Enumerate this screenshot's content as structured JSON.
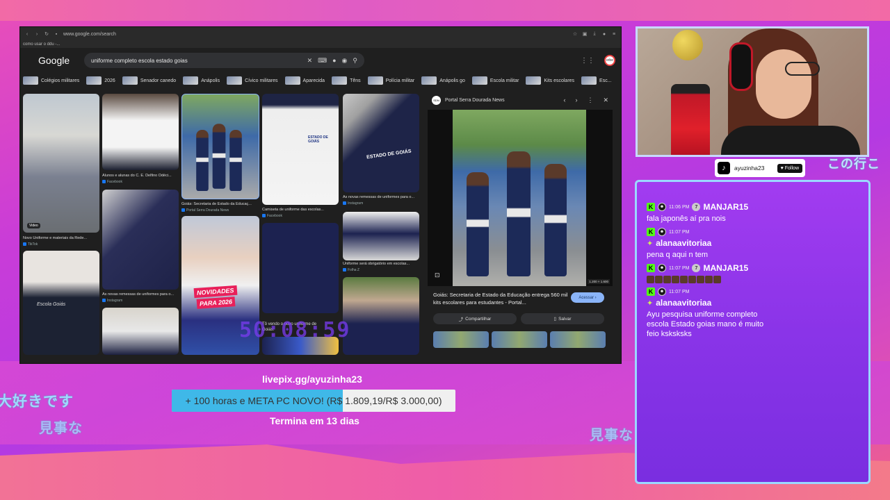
{
  "browser": {
    "url": "www.google.com/search",
    "bookmark": "como usar o ddu -...",
    "google_logo": "Google",
    "search_query": "uniforme completo escola estado goias",
    "chips": [
      "Colégios militares",
      "2026",
      "Senador canedo",
      "Anápolis",
      "Cívico militares",
      "Aparecida",
      "Têns",
      "Polícia militar",
      "Anápolis go",
      "Escola militar",
      "Kits escolares",
      "Esc..."
    ],
    "results": [
      {
        "caption": "Novo Uniforme e materiais da Rede...",
        "source": "TikTok",
        "badge": "Video"
      },
      {
        "caption": "Alunos e alunas do C. E. Delfino Odéci...",
        "source": "Facebook"
      },
      {
        "caption": "Goiás: Secretaria de Estado da Educaç...",
        "source": "Portal Serra Dourada News"
      },
      {
        "caption": "Camiseta de uniforme das escolas...",
        "source": "Facebook"
      },
      {
        "caption": "As novas remessas de uniformes para o...",
        "source": "Instagram"
      },
      {
        "caption": "As novas remessas de uniformes para o...",
        "source": "Instagram"
      },
      {
        "caption": "Uniforme será obrigatório em escolas...",
        "source": "Folha Z"
      },
      {
        "caption": "Tô vendo o novo uniforme de Goiás:",
        "source": "TikTok"
      }
    ],
    "overlay_texts": {
      "novidades": "NOVIDADES",
      "para": "PARA 2026",
      "estado": "ESTADO DE GOIÁS",
      "escola": "Escola Goiás"
    },
    "preview": {
      "source": "Portal Serra Dourada News",
      "dimensions": "1.200 × 1.600",
      "title": "Goiás: Secretaria de Estado da Educação entrega 560 mil kits escolares para estudantes - Portal...",
      "visit_label": "Acessar",
      "share_label": "Compartilhar",
      "save_label": "Salvar"
    }
  },
  "timer": "50:08:59",
  "streamer": {
    "handle": "ayuzinha23",
    "follow_label": "Follow"
  },
  "japanese": {
    "t1": "大好きです",
    "t2": "見事な",
    "t3": "見事な",
    "t4": "この行こ"
  },
  "chat": [
    {
      "time": "11:06 PM",
      "level": "7",
      "user": "MANJAR15",
      "message": "fala japonês aí pra nois"
    },
    {
      "time": "11:07 PM",
      "user": "alanaavitoriaa",
      "message": "pena q aqui n tem"
    },
    {
      "time": "11:07 PM",
      "level": "7",
      "user": "MANJAR15",
      "emotes": 9
    },
    {
      "time": "11:07 PM",
      "user": "alanaavitoriaa",
      "message": "Ayu pesquisa uniforme completo escola Estado goias mano é muito feio ksksksks"
    }
  ],
  "goal": {
    "url": "livepix.gg/ayuzinha23",
    "label": "+ 100 horas e META PC NOVO! (R$ 1.809,19/R$ 3.000,00)",
    "progress": 0.603,
    "ends": "Termina em 13 dias"
  }
}
